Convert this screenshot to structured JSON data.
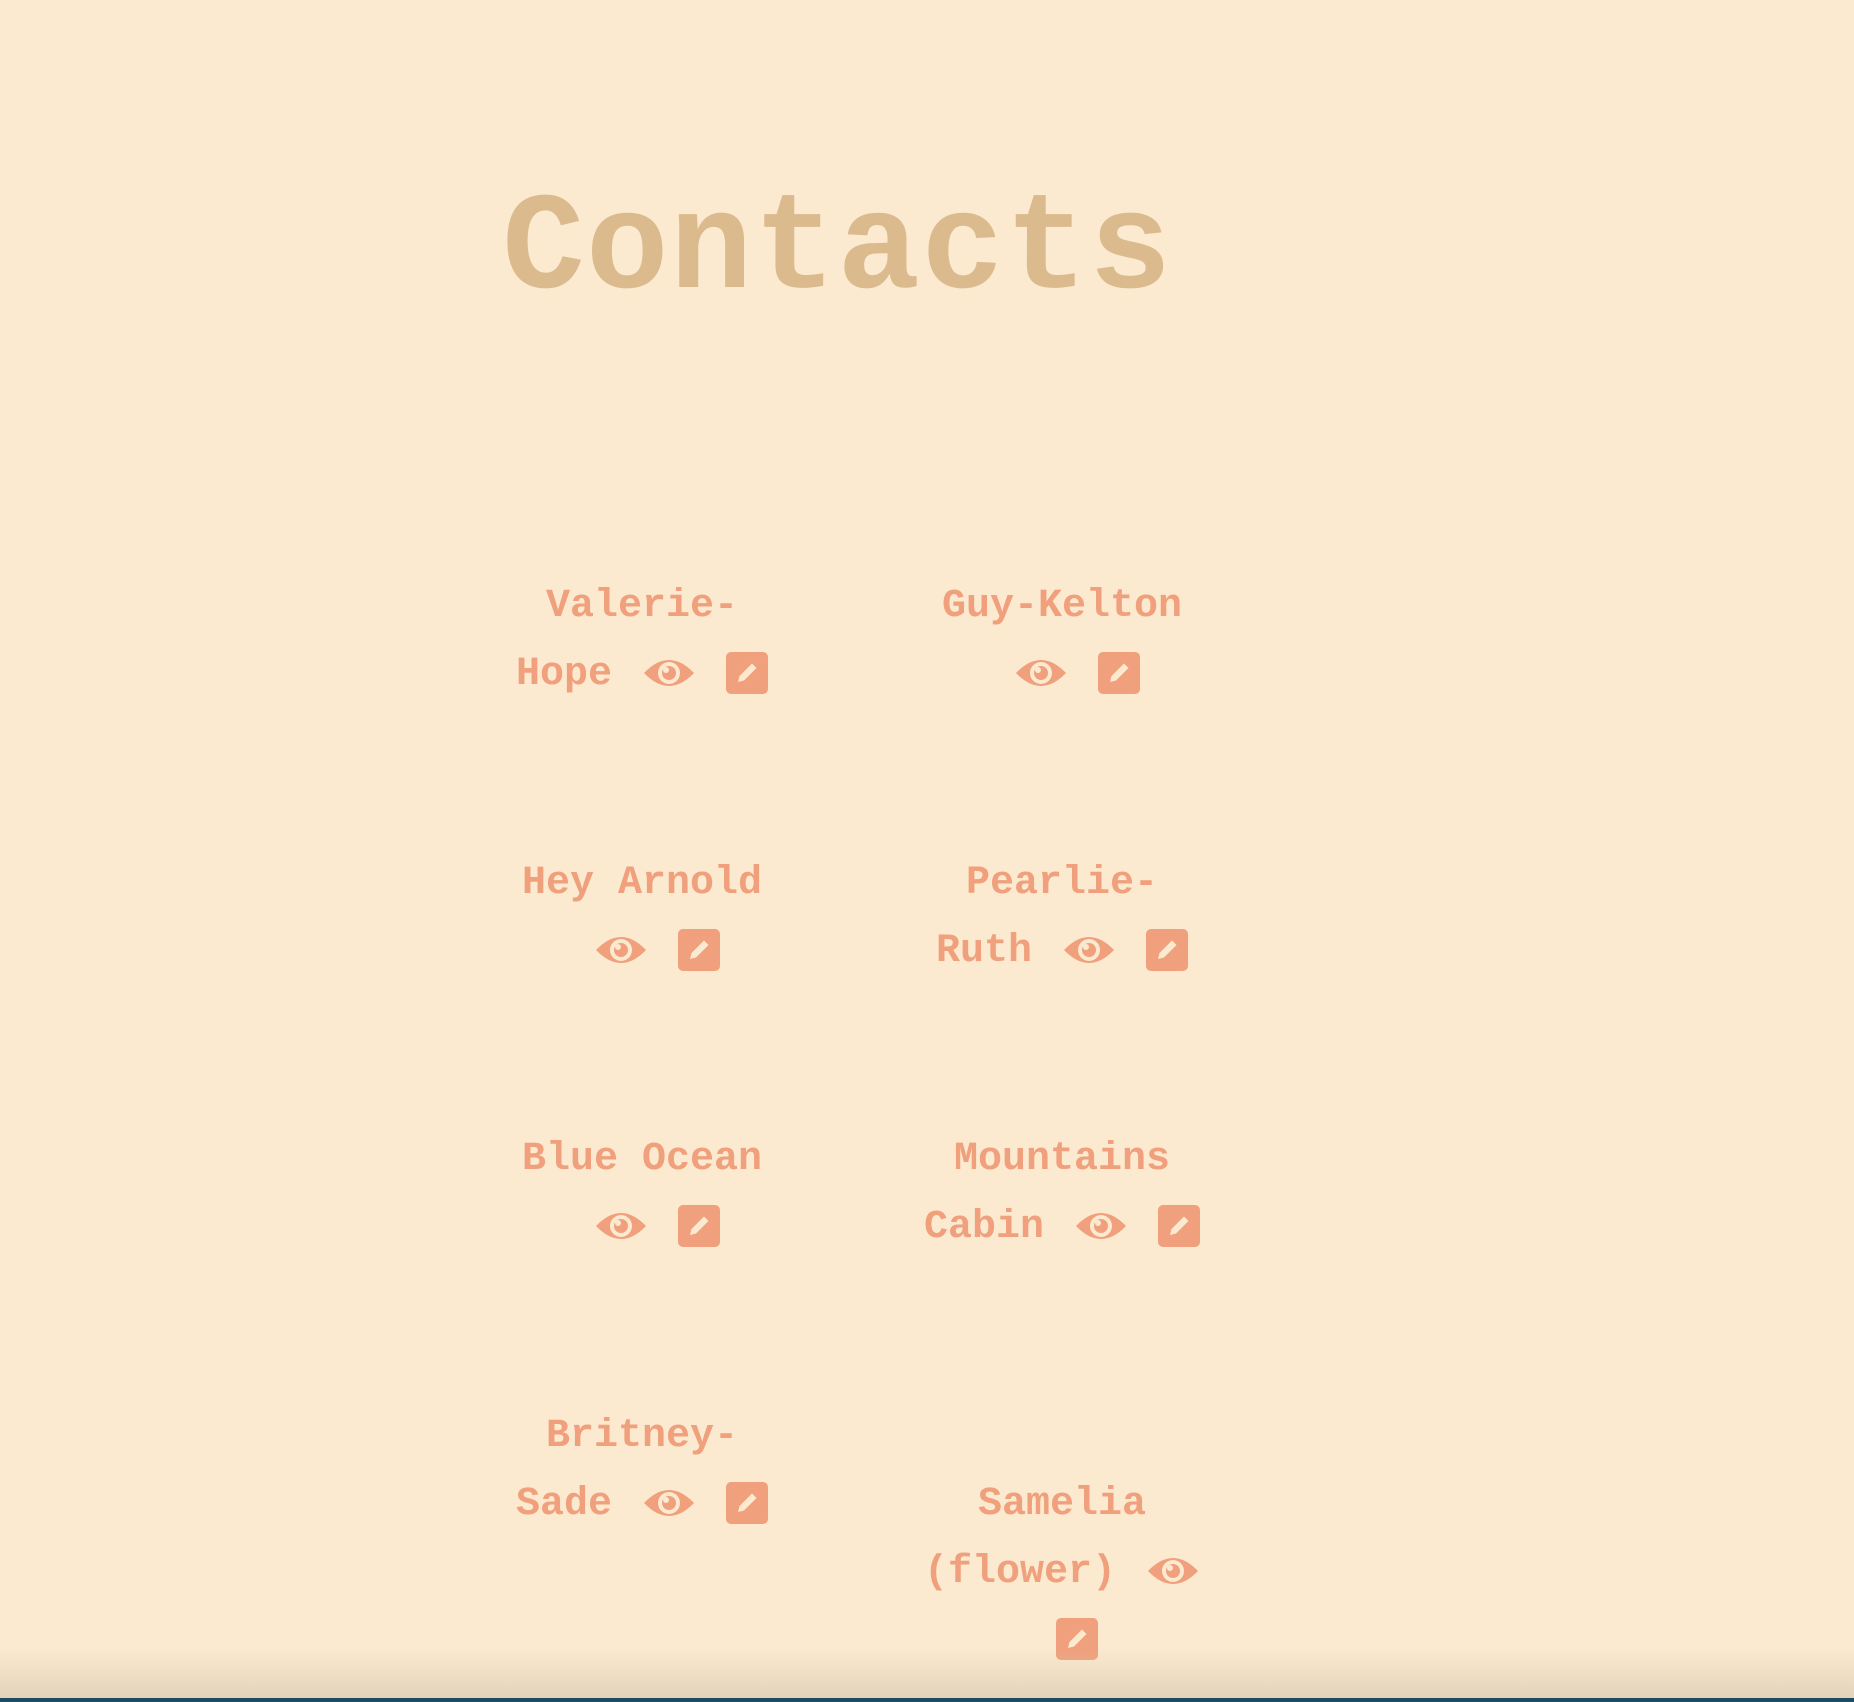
{
  "page": {
    "title": "Contacts"
  },
  "colors": {
    "background": "#fbead0",
    "title": "#dbbb8e",
    "contact_text": "#f0a07c",
    "icon_fill": "#f0a07c",
    "bottom_bar": "#1d4a5e"
  },
  "icons": {
    "view": "eye-icon",
    "edit": "pencil-square-icon"
  },
  "contacts": [
    {
      "name": "Valerie-Hope"
    },
    {
      "name": "Guy-Kelton"
    },
    {
      "name": "Hey Arnold"
    },
    {
      "name": "Pearlie-Ruth"
    },
    {
      "name": "Blue Ocean"
    },
    {
      "name": "Mountains Cabin"
    },
    {
      "name": "Britney-Sade"
    },
    {
      "name": "Samelia (flower)"
    }
  ]
}
